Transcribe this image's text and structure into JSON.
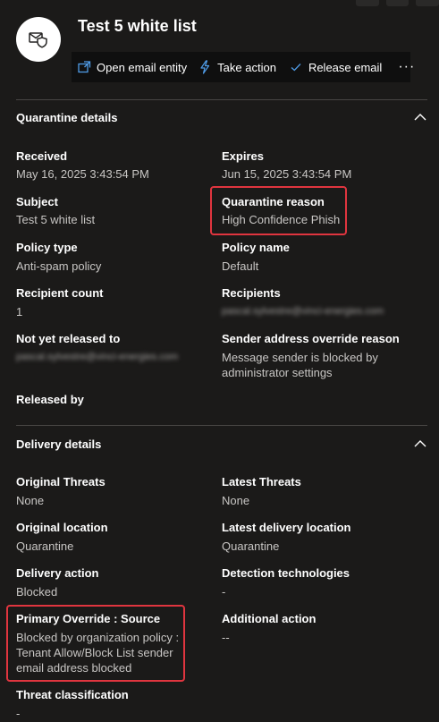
{
  "header": {
    "title": "Test 5 white list",
    "avatar_icon": "mail-shield-icon"
  },
  "toolbar": {
    "open_email_entity": "Open email entity",
    "take_action": "Take action",
    "release_email": "Release email",
    "more": "···"
  },
  "quarantine": {
    "title": "Quarantine details",
    "received_label": "Received",
    "received_value": "May 16, 2025 3:43:54 PM",
    "expires_label": "Expires",
    "expires_value": "Jun 15, 2025 3:43:54 PM",
    "subject_label": "Subject",
    "subject_value": "Test 5 white list",
    "reason_label": "Quarantine reason",
    "reason_value": "High Confidence Phish",
    "policy_type_label": "Policy type",
    "policy_type_value": "Anti-spam policy",
    "policy_name_label": "Policy name",
    "policy_name_value": "Default",
    "recipient_count_label": "Recipient count",
    "recipient_count_value": "1",
    "recipients_label": "Recipients",
    "recipients_value": "pascal.sylvestre@vinci-energies.com",
    "not_released_label": "Not yet released to",
    "not_released_value": "pascal.sylvestre@vinci-energies.com",
    "sender_override_label": "Sender address override reason",
    "sender_override_value_1": "Message sender is blocked by",
    "sender_override_value_2": "administrator settings",
    "released_by_label": "Released by"
  },
  "delivery": {
    "title": "Delivery details",
    "original_threats_label": "Original Threats",
    "original_threats_value": "None",
    "latest_threats_label": "Latest Threats",
    "latest_threats_value": "None",
    "original_location_label": "Original location",
    "original_location_value": "Quarantine",
    "latest_location_label": "Latest delivery location",
    "latest_location_value": "Quarantine",
    "delivery_action_label": "Delivery action",
    "delivery_action_value": "Blocked",
    "detection_label": "Detection technologies",
    "detection_value": "-",
    "primary_override_label": "Primary Override : Source",
    "primary_override_value_1": "Blocked by organization policy :",
    "primary_override_value_2": "Tenant Allow/Block List sender",
    "primary_override_value_3": "email address blocked",
    "additional_action_label": "Additional action",
    "additional_action_value": "--",
    "threat_classification_label": "Threat classification",
    "threat_classification_value": "-"
  },
  "colors": {
    "background": "#1b1a19",
    "toolbar_bg": "#0f0f0f",
    "accent": "#4f9be6",
    "highlight": "#e0353f"
  }
}
